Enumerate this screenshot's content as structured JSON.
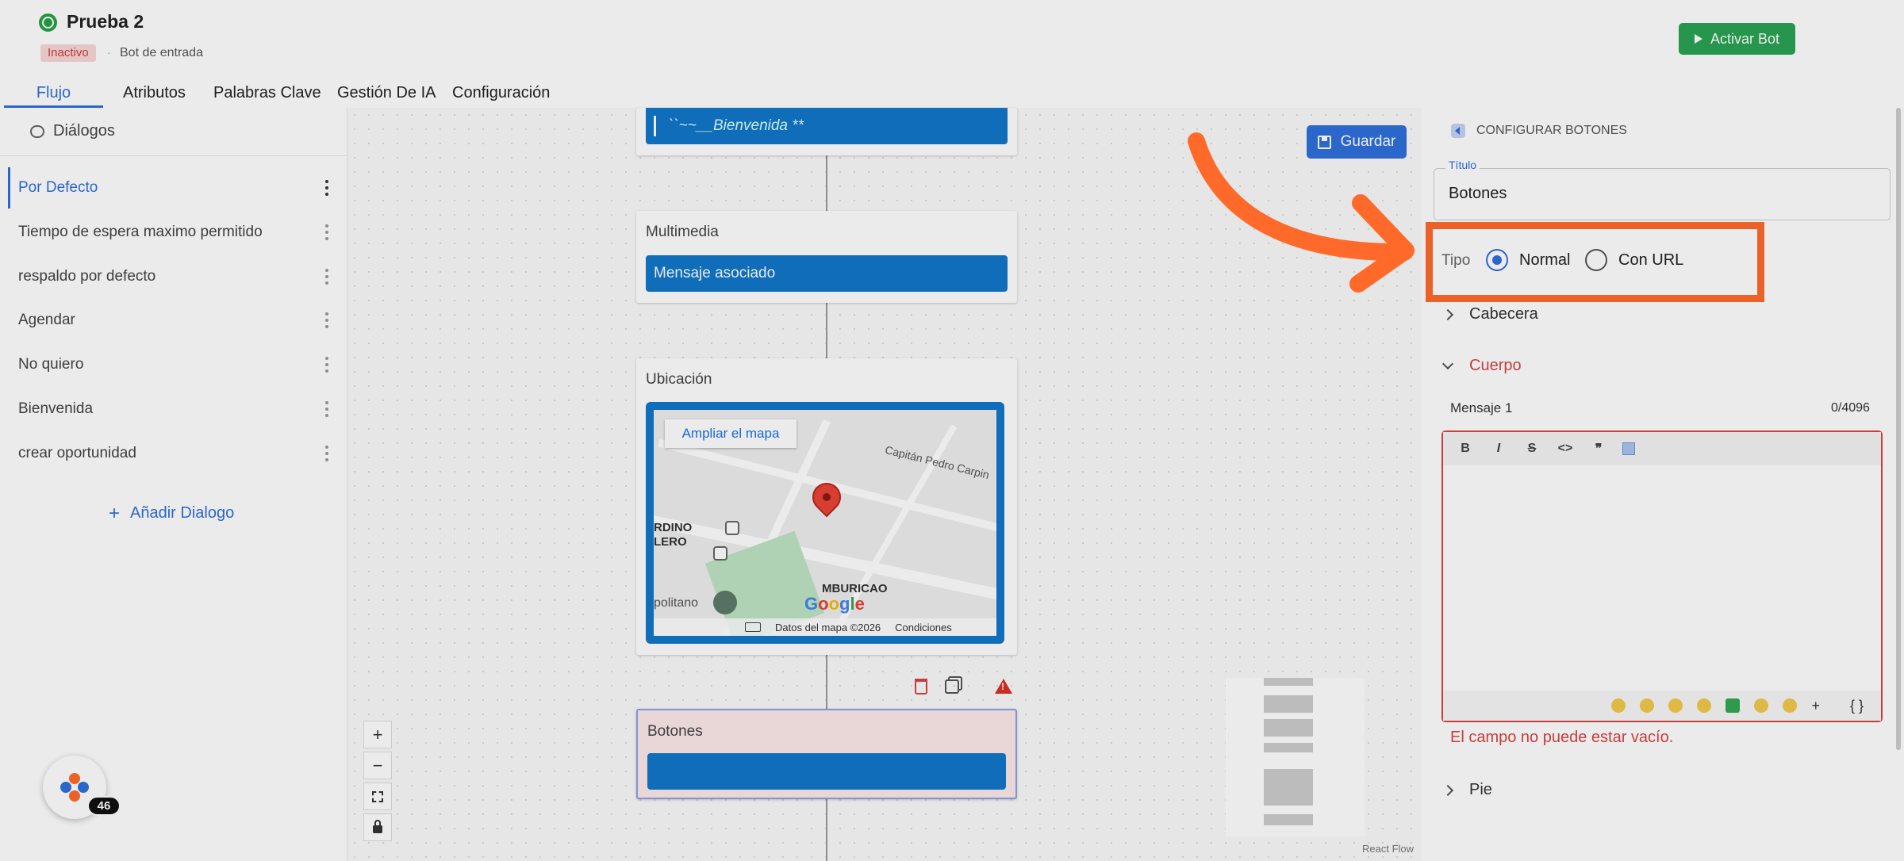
{
  "header": {
    "bot_title": "Prueba 2",
    "status": "Inactivo",
    "subtitle": "Bot de entrada",
    "activate_label": "Activar Bot"
  },
  "tabs": [
    {
      "label": "Flujo",
      "active": true
    },
    {
      "label": "Atributos"
    },
    {
      "label": "Palabras Clave"
    },
    {
      "label": "Gestión De IA"
    },
    {
      "label": "Configuración"
    }
  ],
  "sidebar": {
    "title": "Diálogos",
    "items": [
      {
        "label": "Por Defecto",
        "active": true
      },
      {
        "label": "Tiempo de espera maximo permitido"
      },
      {
        "label": "respaldo por defecto"
      },
      {
        "label": "Agendar"
      },
      {
        "label": "No quiero"
      },
      {
        "label": "Bienvenida"
      },
      {
        "label": "crear oportunidad"
      }
    ],
    "add_label": "Añadir Dialogo"
  },
  "canvas": {
    "save_label": "Guardar",
    "first_node_text": "``~~__Bienvenida **",
    "multimedia": {
      "title": "Multimedia",
      "bar": "Mensaje asociado"
    },
    "location": {
      "title": "Ubicación",
      "map_button": "Ampliar el mapa",
      "street": "Capitán Pedro Carpin",
      "area1": "RDINO",
      "area2": "LERO",
      "area3": "MBURICAO",
      "area4": "politano",
      "google": [
        "G",
        "o",
        "o",
        "g",
        "l",
        "e"
      ],
      "map_data": "Datos del mapa ©2026",
      "conditions": "Condiciones"
    },
    "buttons_node": {
      "title": "Botones"
    },
    "controls": {
      "zoom_in": "+",
      "zoom_out": "−"
    },
    "attribution": "React Flow"
  },
  "floating": {
    "count": "46"
  },
  "panel": {
    "header": "CONFIGURAR BOTONES",
    "title_label": "Título",
    "title_value": "Botones",
    "tipo_label": "Tipo",
    "radio_normal": "Normal",
    "radio_url": "Con URL",
    "selected": "Normal",
    "cabecera": "Cabecera",
    "cuerpo": "Cuerpo",
    "message_label": "Mensaje 1",
    "char_count": "0/4096",
    "toolbar": {
      "bold": "B",
      "italic": "I",
      "strike": "S",
      "code": "<>",
      "quote": "❞"
    },
    "editor_plus": "+",
    "editor_vars": "{ }",
    "error": "El campo no puede estar vacío.",
    "pie": "Pie"
  },
  "colors": {
    "accent": "#2f6fdd",
    "node_bar": "#1177c9",
    "activate": "#29a353",
    "error": "#d94343",
    "highlight": "#ff6a2b"
  }
}
